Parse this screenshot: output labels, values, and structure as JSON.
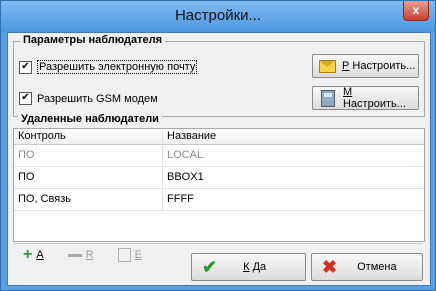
{
  "window": {
    "title": "Настройки...",
    "close_glyph": "x"
  },
  "observer_group": {
    "title": "Параметры наблюдателя",
    "email": {
      "label": "Разрешить электронную почту",
      "checked": true,
      "button_hotkey": "Р",
      "button_rest": " Настроить..."
    },
    "gsm": {
      "label": "Разрешить GSM модем",
      "checked": true,
      "button_hotkey": "М",
      "button_rest": " Настроить..."
    }
  },
  "remote_group": {
    "title": "Удаленные наблюдатели",
    "columns": [
      "Контроль",
      "Название"
    ],
    "rows": [
      {
        "control": "ПО",
        "name": "LOCAL",
        "greyed": true
      },
      {
        "control": "ПО",
        "name": "BBOX1",
        "greyed": false
      },
      {
        "control": "ПО, Связь",
        "name": "FFFF",
        "greyed": false
      }
    ],
    "toolbar": {
      "add_hotkey": "А",
      "remove_hotkey": "R",
      "edit_hotkey": "E"
    }
  },
  "buttons": {
    "ok_hotkey": "К",
    "ok_rest": " Да",
    "cancel": "Отмена"
  },
  "colors": {
    "title_bar": "#5a9fe0",
    "ok_icon": "#2e9a2e",
    "cancel_icon": "#d03020"
  }
}
